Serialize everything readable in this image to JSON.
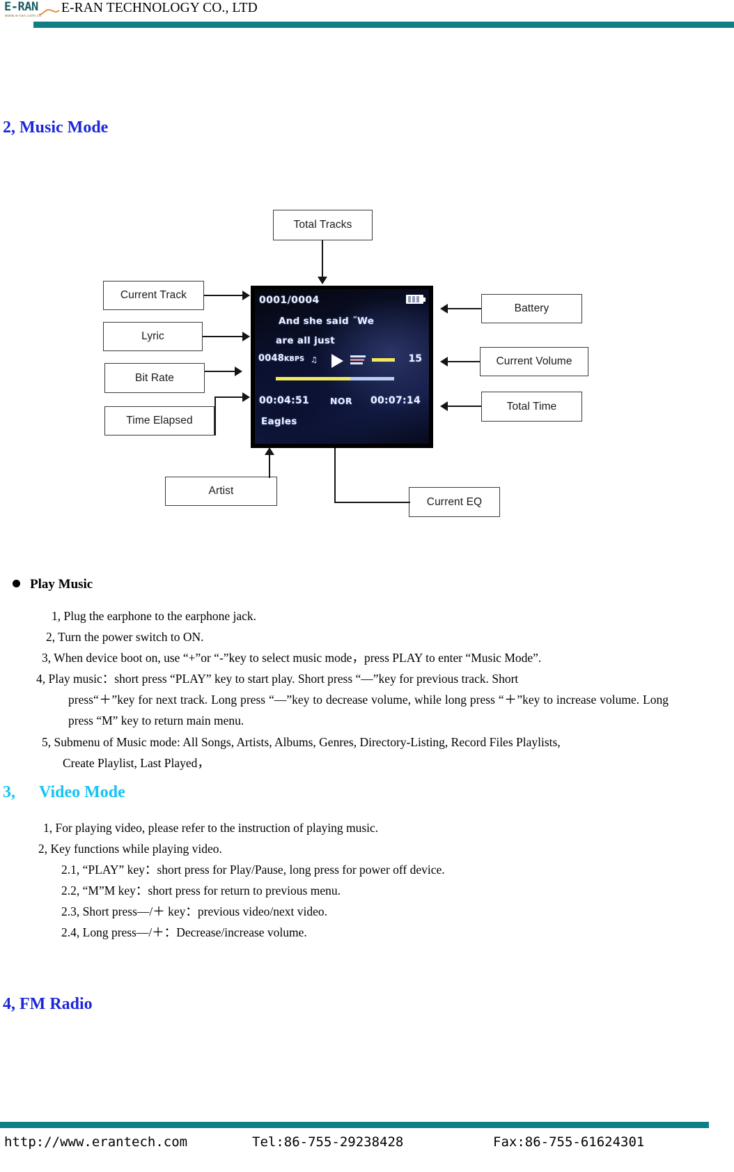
{
  "header": {
    "logo_text": "E-RAN",
    "logo_url": "www.e-ran.com.cn",
    "company": "E-RAN TECHNOLOGY CO., LTD",
    "rule_color": "#0f7f86"
  },
  "headings": {
    "music_mode": "2, Music Mode",
    "video_mode_num": "3,",
    "video_mode": "Video Mode",
    "fm_radio": "4, FM Radio",
    "music_color": "#1c27d8",
    "video_color": "#14c3f5",
    "fm_color": "#1c27d8"
  },
  "diagram": {
    "callouts": {
      "total_tracks": "Total Tracks",
      "current_track": "Current Track",
      "lyric": "Lyric",
      "bit_rate": "Bit Rate",
      "time_elapsed": "Time Elapsed",
      "battery": "Battery",
      "current_volume": "Current Volume",
      "total_time": "Total Time",
      "artist": "Artist",
      "current_eq": "Current EQ"
    },
    "screen": {
      "track_counter": "0001/0004",
      "lyric_line_1": "And she said ˝We",
      "lyric_line_2": "are all just",
      "bitrate_value": "0048",
      "bitrate_unit": "KBPS",
      "note_icon": "♫",
      "volume_level": "15",
      "time_elapsed": "00:04:51",
      "eq_mode": "NOR",
      "total_time": "00:07:14",
      "artist_name": "Eagles",
      "progress_percent": 63
    }
  },
  "play_music": {
    "title": "Play Music",
    "items": {
      "i1": "1, Plug the earphone to the earphone jack.",
      "i2": "2, Turn the power switch to ON.",
      "i3": "3, When device boot on, use “+”or “-”key to select music mode，press PLAY to enter “Music Mode”.",
      "i4_a": "4, Play music：short press “PLAY” key to start play. Short press “—”key for previous track. Short",
      "i4_b": "press“＋”key for next track. Long press “—”key to decrease volume, while long press “＋”key to increase volume. Long press “M” key to return main menu.",
      "i5_a": "5, Submenu of Music mode: All Songs, Artists, Albums, Genres, Directory-Listing, Record Files Playlists,",
      "i5_b": "Create Playlist, Last Played，"
    }
  },
  "video_mode": {
    "items": {
      "v1": "1, For playing video, please refer to the instruction of playing music.",
      "v2": "2, Key functions while playing video.",
      "v21": "2.1, “PLAY” key：short press for Play/Pause, long press for power off device.",
      "v22": "2.2, “M”M key：short press for return to previous menu.",
      "v23": "2.3, Short press—/＋ key：previous video/next video.",
      "v24": "2.4, Long press—/＋：Decrease/increase volume."
    }
  },
  "footer": {
    "website": "http://www.erantech.com",
    "tel": "Tel:86-755-29238428",
    "fax": "Fax:86-755-61624301",
    "rule_color": "#0f7f86"
  }
}
